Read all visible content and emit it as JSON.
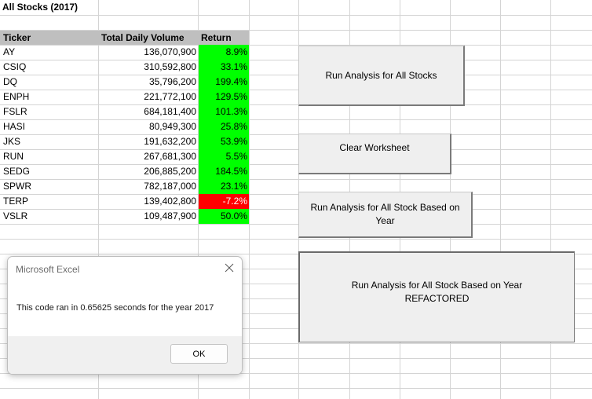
{
  "sheet": {
    "title": "All Stocks (2017)",
    "headers": {
      "ticker": "Ticker",
      "volume": "Total Daily Volume",
      "return": "Return"
    },
    "rows": [
      {
        "ticker": "AY",
        "volume": "136,070,900",
        "return": "8.9%",
        "status": "positive"
      },
      {
        "ticker": "CSIQ",
        "volume": "310,592,800",
        "return": "33.1%",
        "status": "positive"
      },
      {
        "ticker": "DQ",
        "volume": "35,796,200",
        "return": "199.4%",
        "status": "positive"
      },
      {
        "ticker": "ENPH",
        "volume": "221,772,100",
        "return": "129.5%",
        "status": "positive"
      },
      {
        "ticker": "FSLR",
        "volume": "684,181,400",
        "return": "101.3%",
        "status": "positive"
      },
      {
        "ticker": "HASI",
        "volume": "80,949,300",
        "return": "25.8%",
        "status": "positive"
      },
      {
        "ticker": "JKS",
        "volume": "191,632,200",
        "return": "53.9%",
        "status": "positive"
      },
      {
        "ticker": "RUN",
        "volume": "267,681,300",
        "return": "5.5%",
        "status": "positive"
      },
      {
        "ticker": "SEDG",
        "volume": "206,885,200",
        "return": "184.5%",
        "status": "positive"
      },
      {
        "ticker": "SPWR",
        "volume": "782,187,000",
        "return": "23.1%",
        "status": "positive"
      },
      {
        "ticker": "TERP",
        "volume": "139,402,800",
        "return": "-7.2%",
        "status": "negative"
      },
      {
        "ticker": "VSLR",
        "volume": "109,487,900",
        "return": "50.0%",
        "status": "positive"
      }
    ]
  },
  "buttons": {
    "run_all": "Run Analysis for All Stocks",
    "clear": "Clear Worksheet",
    "run_year": "Run Analysis for All Stock Based on Year",
    "run_refactored_line1": "Run Analysis for All Stock Based on Year",
    "run_refactored_line2": "REFACTORED"
  },
  "dialog": {
    "title": "Microsoft Excel",
    "message": "This code ran in 0.65625 seconds for the year 2017",
    "ok_label": "OK",
    "close_icon": "close-icon"
  },
  "colors": {
    "positive": "#00ff00",
    "negative": "#ff0000",
    "header_bg": "#bfbfbf",
    "button_bg": "#efefef"
  }
}
